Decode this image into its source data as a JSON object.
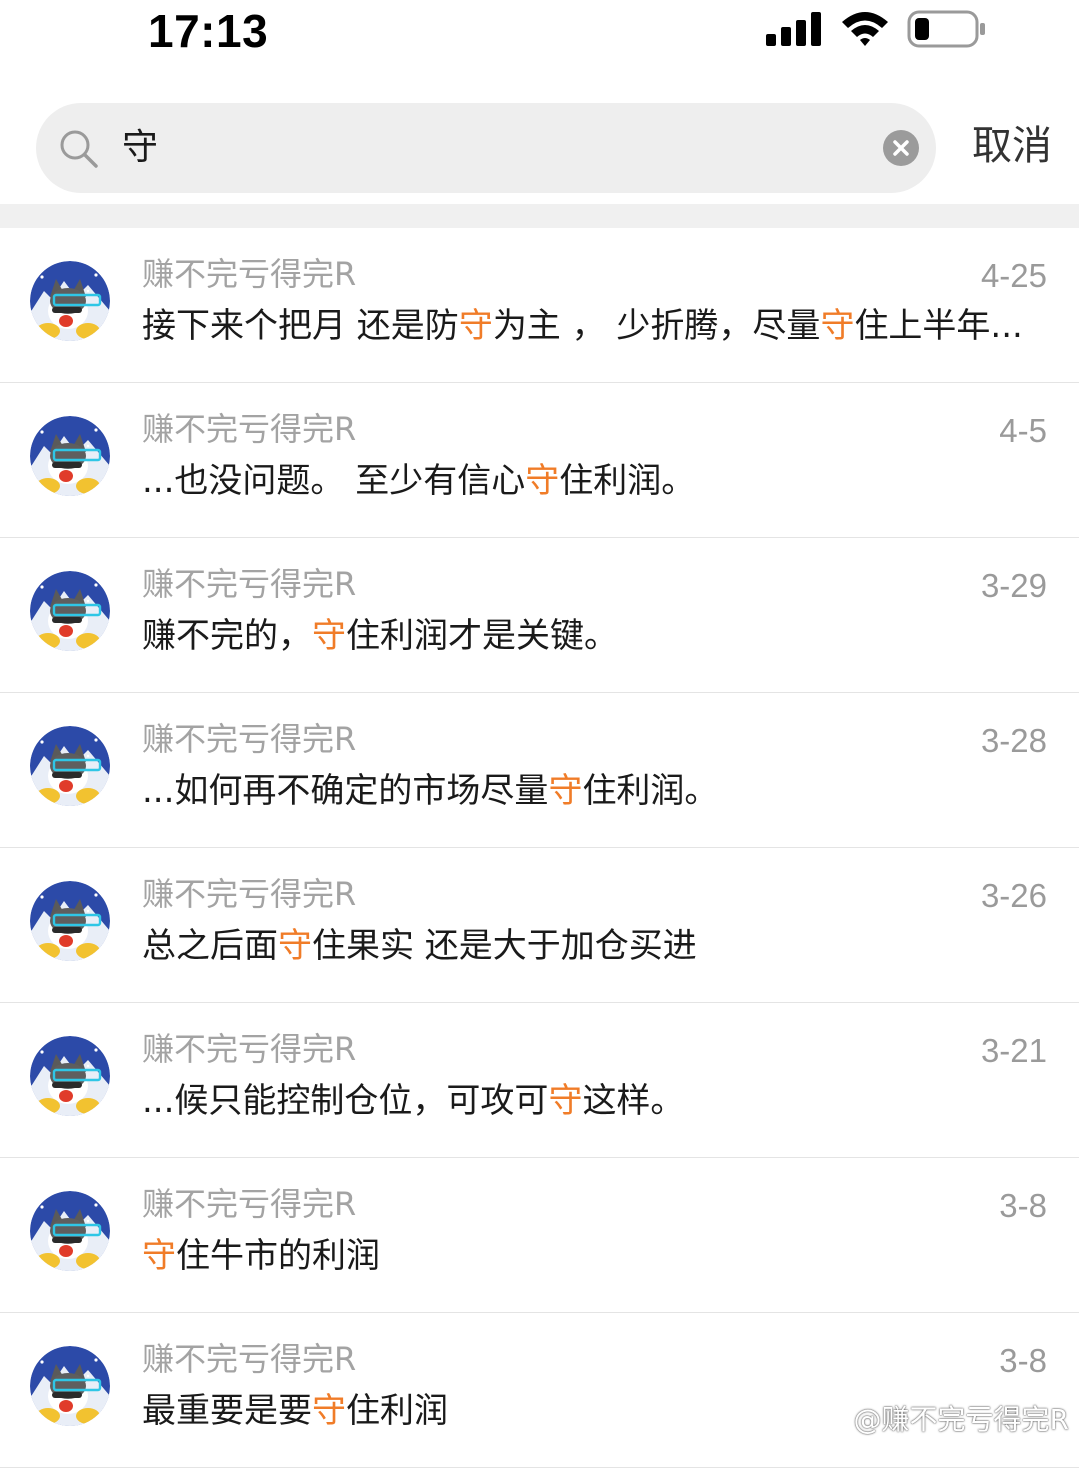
{
  "status_bar": {
    "time": "17:13",
    "icons": [
      "signal-icon",
      "wifi-icon",
      "battery-icon"
    ]
  },
  "search": {
    "query": "守",
    "cancel_label": "取消",
    "icons": [
      "search-icon",
      "clear-icon"
    ]
  },
  "colors": {
    "highlight": "#f07c28",
    "author": "#a3a3a3",
    "date": "#9a9a9a",
    "search_bg": "#eeeeee",
    "divider": "#e4e4e4"
  },
  "results": [
    {
      "author": "赚不完亏得完R",
      "date": "4-25",
      "snippet_parts": [
        "接下来个把月 还是防",
        "守",
        "为主 ， 少折腾，尽量",
        "守",
        "住上半年..."
      ]
    },
    {
      "author": "赚不完亏得完R",
      "date": "4-5",
      "snippet_parts": [
        "...也没问题。 至少有信心",
        "守",
        "住利润。"
      ]
    },
    {
      "author": "赚不完亏得完R",
      "date": "3-29",
      "snippet_parts": [
        "赚不完的，",
        "守",
        "住利润才是关键。"
      ]
    },
    {
      "author": "赚不完亏得完R",
      "date": "3-28",
      "snippet_parts": [
        "...如何再不确定的市场尽量",
        "守",
        "住利润。"
      ]
    },
    {
      "author": "赚不完亏得完R",
      "date": "3-26",
      "snippet_parts": [
        "总之后面",
        "守",
        "住果实 还是大于加仓买进"
      ]
    },
    {
      "author": "赚不完亏得完R",
      "date": "3-21",
      "snippet_parts": [
        "...候只能控制仓位，可攻可",
        "守",
        "这样。"
      ]
    },
    {
      "author": "赚不完亏得完R",
      "date": "3-8",
      "snippet_parts": [
        "",
        "守",
        "住牛市的利润"
      ]
    },
    {
      "author": "赚不完亏得完R",
      "date": "3-8",
      "snippet_parts": [
        "最重要是要",
        "守",
        "住利润"
      ]
    }
  ],
  "watermark": {
    "text": "@赚不完亏得完R",
    "icon": "weibo-logo-icon"
  }
}
